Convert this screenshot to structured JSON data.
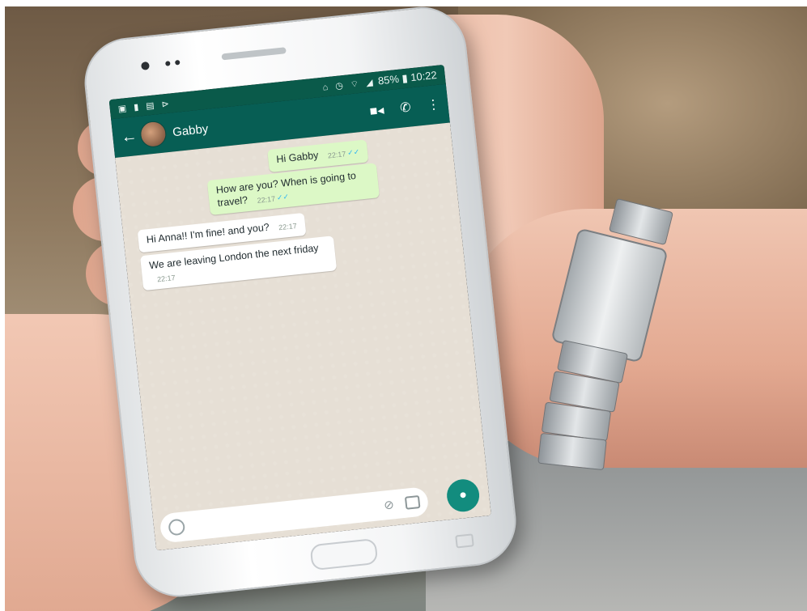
{
  "status_bar": {
    "left_icons": [
      "image-icon",
      "sim-icon",
      "message-icon",
      "media-icon"
    ],
    "right_icons": [
      "nfc-icon",
      "alarm-icon",
      "wifi-icon",
      "signal-icon",
      "battery-icon"
    ],
    "battery": "85%",
    "time": "10:22"
  },
  "app_bar": {
    "contact_name": "Gabby",
    "icons": [
      "back-arrow-icon",
      "video-call-icon",
      "phone-icon",
      "more-vert-icon"
    ],
    "color": "#075e54"
  },
  "messages": [
    {
      "direction": "out",
      "text": "Hi Gabby",
      "time": "22:17",
      "status": "read"
    },
    {
      "direction": "out",
      "text": "How are you? When is going to travel?",
      "time": "22:17",
      "status": "read"
    },
    {
      "direction": "in",
      "text": "Hi Anna!! I'm fine! and you?",
      "time": "22:17"
    },
    {
      "direction": "in",
      "text": "We are leaving London the next friday",
      "time": "22:17"
    }
  ],
  "composer": {
    "icons": [
      "emoji-icon",
      "attach-icon",
      "camera-icon"
    ],
    "send_icon": "mic-icon",
    "accent": "#128c7e"
  },
  "colors": {
    "outgoing_bubble": "#dcf8c6",
    "incoming_bubble": "#ffffff",
    "chat_background": "#e6dfd5"
  }
}
